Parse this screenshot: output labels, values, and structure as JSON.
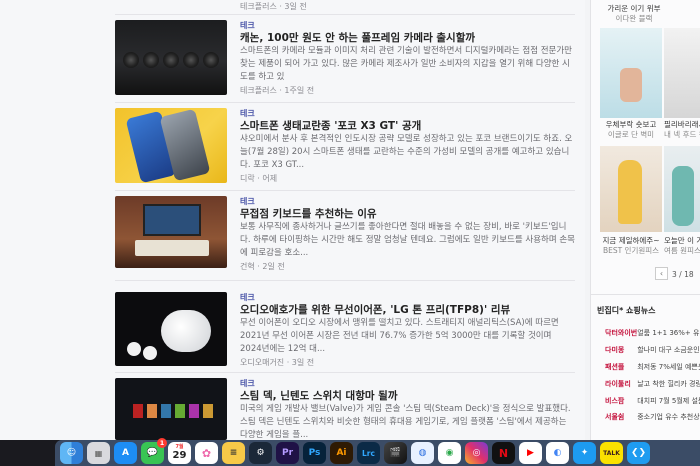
{
  "articles": [
    {
      "meta": "테크플러스 · 3일 전"
    },
    {
      "category": "테크",
      "title": "캐논, 100만 원도 안 하는 풀프레임 카메라 출시할까",
      "desc": "스마트폰의 카메라 모듈과 이미지 처리 관련 기술이 발전하면서 디지털카메라는 점점 전문가만 찾는 제품이 되어 가고 있다. 많은 카메라 제조사가 일반 소비자의 지갑을 열기 위해 다양한 시도를 하고 있",
      "meta": "테크플러스 · 1주일 전"
    },
    {
      "category": "테크",
      "title": "스마트폰 생태교란종 '포코 X3 GT' 공개",
      "desc": "샤오미에서 분사 후 본격적인 인도시장 공략 모델로 성장하고 있는 포코 브랜드이기도 하죠. 오늘(7월 28일) 20시 스마트폰 생태를 교란하는 수준의 가성비 모델의 공개를 예고하고 있습니다. 포코 X3 GT...",
      "meta": "디락 · 어제"
    },
    {
      "category": "테크",
      "title": "무접점 키보드를 추천하는 이유",
      "desc": "보통 사무직에 종사하거나 글쓰기를 좋아한다면 절대 배놓을 수 없는 장비, 바로 '키보드'입니다. 하루에 타이핑하는 시간만 해도 정말 엄청날 텐데요. 그럼에도 일반 키보드를 사용하며 손목에 피로감을 호소...",
      "meta": "건혁 · 2일 전"
    },
    {
      "category": "테크",
      "title": "오디오애호가를 위한 무선이어폰, 'LG 톤 프리(TFP8)' 리뷰",
      "desc": "무선 이어폰이 오디오 시장에서 맹위를 떨치고 있다. 스트래티지 애널리틱스(SA)에 따르면 2021년 무선 이어폰 시장은 전년 대비 76.7% 증가한 5억 3000만 대를 기록할 것이며 2024년에는 12억 대...",
      "meta": "오디오매거진 · 3일 전"
    },
    {
      "category": "테크",
      "title": "스팀 덱, 닌텐도 스위치 대항마 될까",
      "desc": "미국의 게임 개발사 밸브(Valve)가 게임 콘솔 '스팀 덱(Steam Deck)'을 정식으로 발표했다. 스팀 덱은 닌텐도 스위치와 비슷한 형태의 휴대용 게임기로, 게임 플랫폼 '스팀'에서 제공하는 다양한 게임을 플...",
      "meta": ""
    }
  ],
  "sidebar": {
    "top_items": [
      {
        "title": "가리운 이기 위부",
        "sub": "이다완 블랙"
      },
      {
        "title": "우체부락 숏보고",
        "sub": "이글로 단 벽미"
      },
      {
        "title": "필리바리래시",
        "sub": "내 넥 후드 원피스"
      },
      {
        "title": "지금 제일하에주~",
        "sub": "BEST 인기원피스"
      },
      {
        "title": "오늘만 이 가격",
        "sub": "여름 원피스"
      }
    ],
    "pager": "3 / 18",
    "shopping_title": "빈집디* 쇼핑뉴스",
    "shopping": [
      {
        "shop": "닥터와이번",
        "item": "얼룸 1+1 36%+ 유"
      },
      {
        "shop": "다미몽",
        "item": "할나미 대구 소금운인 할머"
      },
      {
        "shop": "패션플",
        "item": "최저동 7%세일 예쁜옷 핫한"
      },
      {
        "shop": "라이툴리",
        "item": "날고 착한 힐리카 경량팩"
      },
      {
        "shop": "비스팜",
        "item": "대치피 7월 5월제 설문 시네"
      },
      {
        "shop": "서울쉼",
        "item": "중소기업 유수 추천상품 유"
      }
    ]
  },
  "dock": {
    "messages_badge": "1",
    "calendar_month": "7월",
    "calendar_day": "29",
    "apps": [
      "finder-icon",
      "launchpad-icon",
      "app-store-icon",
      "messages-icon",
      "calendar-icon",
      "photos-icon",
      "notes-icon",
      "steam-icon",
      "premiere-icon",
      "photoshop-icon",
      "illustrator-icon",
      "lightroom-classic-icon",
      "final-cut-icon",
      "vpn-icon",
      "kakao-icon",
      "instagram-icon",
      "netflix-icon",
      "youtube-icon",
      "chrome-icon",
      "twitter-icon",
      "kakaotalk-icon",
      "vscode-icon"
    ],
    "labels": {
      "pr": "Pr",
      "ps": "Ps",
      "ai": "Ai",
      "lrc": "Lrc",
      "talk": "TALK"
    }
  }
}
